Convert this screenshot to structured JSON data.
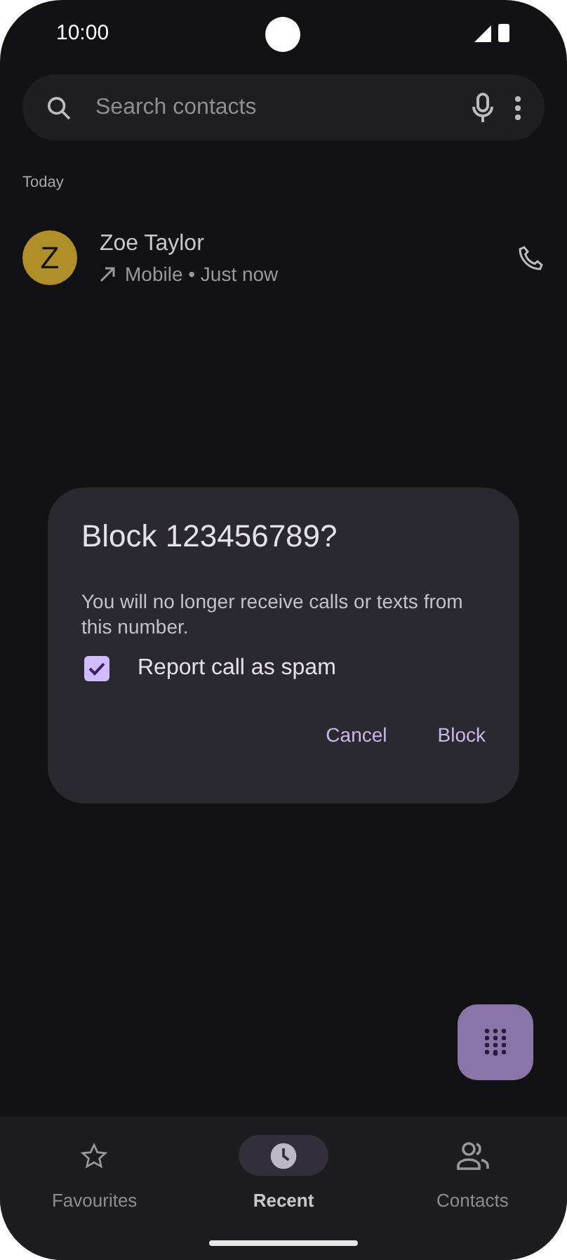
{
  "status_bar": {
    "time": "10:00"
  },
  "search": {
    "placeholder": "Search contacts"
  },
  "section_header": "Today",
  "calls": [
    {
      "initial": "Z",
      "color": "#b08f2a",
      "name": "Zoe Taylor",
      "detail": "Mobile • Just now"
    }
  ],
  "dialog": {
    "title": "Block 123456789?",
    "message": "You will no longer receive calls or texts from this number.",
    "checkbox": {
      "label": "Report call as spam",
      "checked": true
    },
    "buttons": [
      "Cancel",
      "Block"
    ]
  },
  "nav": [
    {
      "kind": "star",
      "label": "Favourites",
      "selected": false
    },
    {
      "kind": "clock",
      "label": "Recent",
      "selected": true
    },
    {
      "kind": "people",
      "label": "Contacts",
      "selected": false
    }
  ]
}
